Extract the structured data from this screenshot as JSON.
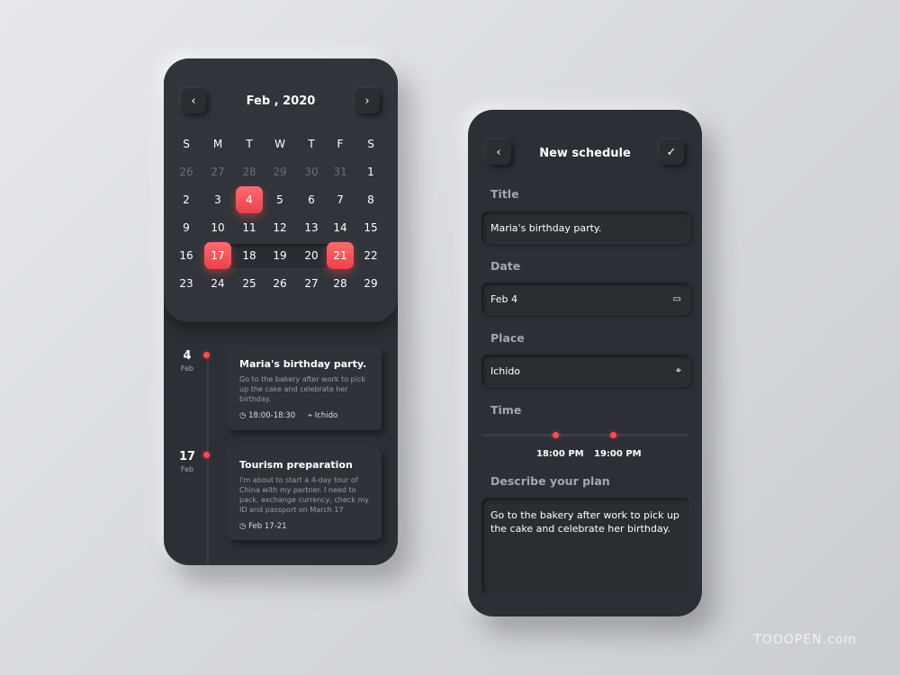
{
  "calendar": {
    "title": "Feb , 2020",
    "weekdays": [
      "S",
      "M",
      "T",
      "W",
      "T",
      "F",
      "S"
    ],
    "weeks": [
      [
        "26",
        "27",
        "28",
        "29",
        "30",
        "31",
        "1"
      ],
      [
        "2",
        "3",
        "4",
        "5",
        "6",
        "7",
        "8"
      ],
      [
        "9",
        "10",
        "11",
        "12",
        "13",
        "14",
        "15"
      ],
      [
        "16",
        "17",
        "18",
        "19",
        "20",
        "21",
        "22"
      ],
      [
        "23",
        "24",
        "25",
        "26",
        "27",
        "28",
        "29"
      ]
    ],
    "selected": [
      "4",
      "17",
      "21"
    ],
    "accent": "#ff4b55"
  },
  "events": [
    {
      "day": "4",
      "month": "Feb",
      "title": "Maria's birthday party.",
      "desc": "Go to the bakery after work to pick up the cake and celebrate her birthday.",
      "time": "18:00-18:30",
      "place": "Ichido"
    },
    {
      "day": "17",
      "month": "Feb",
      "title": "Tourism preparation",
      "desc": "I'm about to start a 4-day tour of China with my partner. I need to pack, exchange currency, check my ID and passport on March 17",
      "time": "Feb 17-21"
    }
  ],
  "schedule": {
    "header": "New schedule",
    "title_label": "Title",
    "title_value": "Maria's birthday party.",
    "date_label": "Date",
    "date_value": "Feb 4",
    "place_label": "Place",
    "place_value": "Ichido",
    "time_label": "Time",
    "time_start": "18:00 PM",
    "time_end": "19:00 PM",
    "desc_label": "Describe your plan",
    "desc_value": "Go to the bakery after work to pick up the cake and celebrate her birthday."
  },
  "watermark": "TOOOPEN.com"
}
